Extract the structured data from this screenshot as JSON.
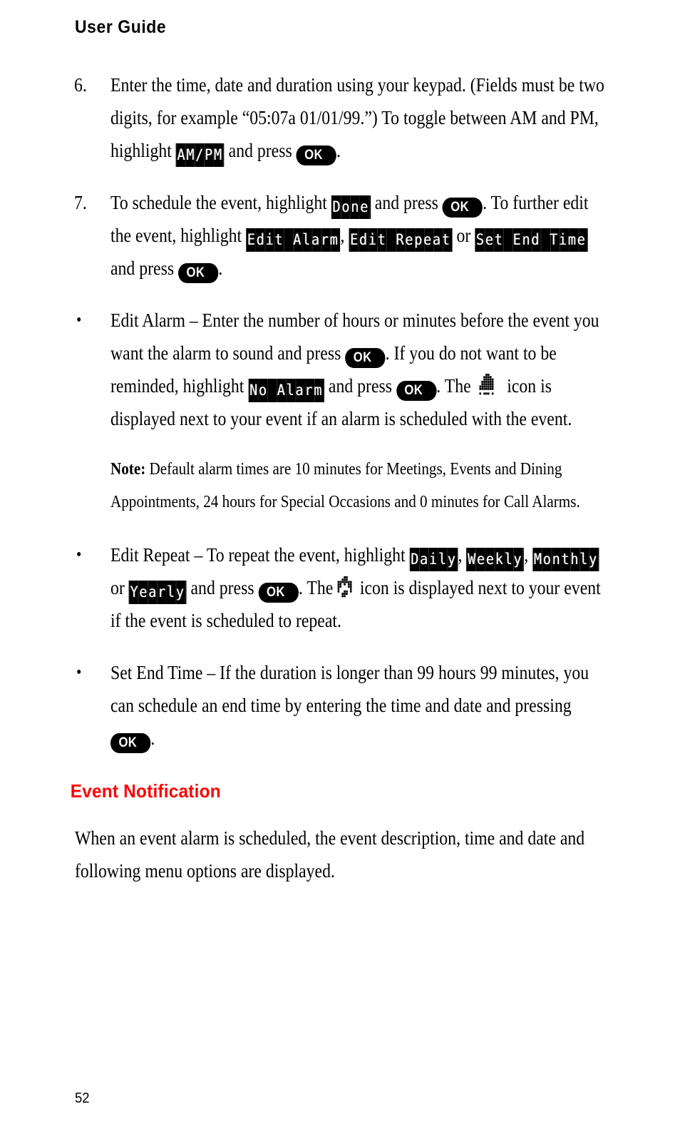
{
  "header": {
    "running_title": "User Guide"
  },
  "colors": {
    "accent_heading": "#FF0000",
    "key_background": "#000000",
    "key_text": "#FFFFFF",
    "body_text": "#000000",
    "page_background": "#FFFFFF"
  },
  "keys": {
    "ok_label": "OK"
  },
  "lcd_labels": {
    "am_pm": "AM/PM",
    "done": "Done",
    "edit_alarm": "Edit Alarm",
    "edit_repeat": "Edit Repeat",
    "set_end_time": "Set End Time",
    "no_alarm": "No Alarm",
    "daily": "Daily",
    "weekly": "Weekly",
    "monthly": "Monthly",
    "yearly": "Yearly"
  },
  "icons": {
    "alarm_icon_name": "alarm-bell-pixel-icon",
    "repeat_icon_name": "repeat-cycle-pixel-icon"
  },
  "steps": [
    {
      "marker": "6.",
      "name": "step-enter-time-date-duration",
      "segments": [
        {
          "t": "text",
          "v": "Enter the time, date and duration using your keypad. (Fields must be two digits, for example “05:07a  01/01/99.”) To toggle between AM and PM, highlight "
        },
        {
          "t": "lcd",
          "v": "AM/PM"
        },
        {
          "t": "text",
          "v": " and press "
        },
        {
          "t": "okkey",
          "v": "OK"
        },
        {
          "t": "text",
          "v": "."
        }
      ]
    },
    {
      "marker": "7.",
      "name": "step-schedule-or-edit-event",
      "segments": [
        {
          "t": "text",
          "v": "To schedule the event, highlight "
        },
        {
          "t": "lcd",
          "v": "Done"
        },
        {
          "t": "text",
          "v": " and press "
        },
        {
          "t": "okkey",
          "v": "OK"
        },
        {
          "t": "text",
          "v": ". To further edit the event, highlight "
        },
        {
          "t": "lcd",
          "v": "Edit Alarm"
        },
        {
          "t": "text",
          "v": ", "
        },
        {
          "t": "lcd",
          "v": "Edit Repeat"
        },
        {
          "t": "text",
          "v": " or "
        },
        {
          "t": "lcd",
          "v": "Set End Time"
        },
        {
          "t": "text",
          "v": " and press "
        },
        {
          "t": "okkey",
          "v": "OK"
        },
        {
          "t": "text",
          "v": "."
        }
      ]
    }
  ],
  "bullets": [
    {
      "marker": "•",
      "name": "bullet-edit-alarm",
      "segments": [
        {
          "t": "text",
          "v": "Edit Alarm – Enter the number of hours or minutes before the event you want the alarm to sound and press "
        },
        {
          "t": "okkey",
          "v": "OK"
        },
        {
          "t": "text",
          "v": ". If you do not want to be reminded, highlight "
        },
        {
          "t": "lcd",
          "v": "No Alarm"
        },
        {
          "t": "text",
          "v": " and press "
        },
        {
          "t": "okkey",
          "v": "OK"
        },
        {
          "t": "text",
          "v": ". The "
        },
        {
          "t": "icon",
          "v": "alarm"
        },
        {
          "t": "text",
          "v": " icon is displayed next to your event if an alarm is scheduled with the event."
        }
      ]
    },
    {
      "marker": "•",
      "name": "bullet-edit-repeat",
      "segments": [
        {
          "t": "text",
          "v": "Edit Repeat – To repeat the event, highlight "
        },
        {
          "t": "lcd",
          "v": "Daily"
        },
        {
          "t": "text",
          "v": ", "
        },
        {
          "t": "lcd",
          "v": "Weekly"
        },
        {
          "t": "text",
          "v": ", "
        },
        {
          "t": "lcd",
          "v": "Monthly"
        },
        {
          "t": "text",
          "v": " or "
        },
        {
          "t": "lcd",
          "v": "Yearly"
        },
        {
          "t": "text",
          "v": " and press "
        },
        {
          "t": "okkey",
          "v": "OK"
        },
        {
          "t": "text",
          "v": ". The "
        },
        {
          "t": "icon",
          "v": "repeat"
        },
        {
          "t": "text",
          "v": "icon is displayed next to your event if the event is scheduled to repeat."
        }
      ]
    },
    {
      "marker": "•",
      "name": "bullet-set-end-time",
      "segments": [
        {
          "t": "text",
          "v": "Set End Time – If the duration is longer than 99 hours 99 minutes, you can schedule an end time by entering the time and date and pressing "
        },
        {
          "t": "okkey",
          "v": "OK"
        },
        {
          "t": "text",
          "v": "."
        }
      ]
    }
  ],
  "note": {
    "label": "Note:",
    "text": " Default alarm times are 10 minutes for Meetings, Events and Dining Appointments, 24 hours for Special Occasions and 0 minutes for Call Alarms."
  },
  "section": {
    "heading": "Event Notification",
    "body": "When an event alarm is scheduled, the event description, time and date and following menu options are displayed."
  },
  "footer": {
    "page_number": "52"
  }
}
